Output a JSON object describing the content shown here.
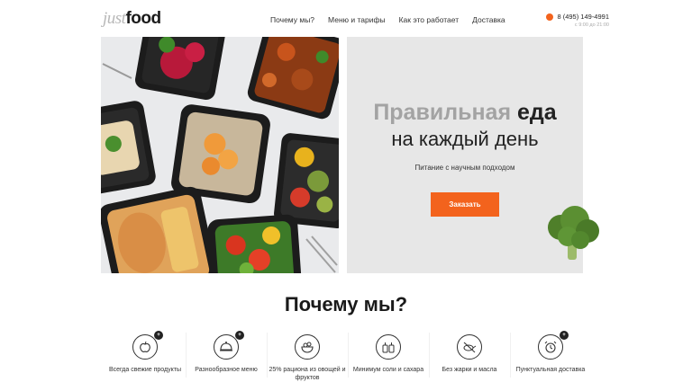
{
  "header": {
    "logo_light": "just",
    "logo_bold": "food",
    "nav": [
      "Почему мы?",
      "Меню и тарифы",
      "Как это работает",
      "Доставка"
    ],
    "phone": "8 (495) 149-4991",
    "hours": "с 9:00 до 21:00"
  },
  "hero": {
    "title_grey": "Правильная",
    "title_dark": "еда",
    "title_line2": "на каждый день",
    "subtitle": "Питание с научным подходом",
    "order_button": "Заказать"
  },
  "why": {
    "title": "Почему мы?",
    "features": [
      {
        "label": "Всегда свежие продукты",
        "badge": "+",
        "icon": "apple-icon"
      },
      {
        "label": "Разнообразное меню",
        "badge": "+",
        "icon": "cloche-icon"
      },
      {
        "label": "25% рациона из овощей и фруктов",
        "badge": "",
        "icon": "salad-bowl-icon"
      },
      {
        "label": "Минимум соли и сахара",
        "badge": "",
        "icon": "salt-sugar-icon"
      },
      {
        "label": "Без жарки и масла",
        "badge": "",
        "icon": "no-frying-pan-icon"
      },
      {
        "label": "Пунктуальная доставка",
        "badge": "+",
        "icon": "alarm-clock-icon"
      }
    ]
  },
  "colors": {
    "accent": "#f3631d",
    "panel": "#e7e7e7"
  }
}
